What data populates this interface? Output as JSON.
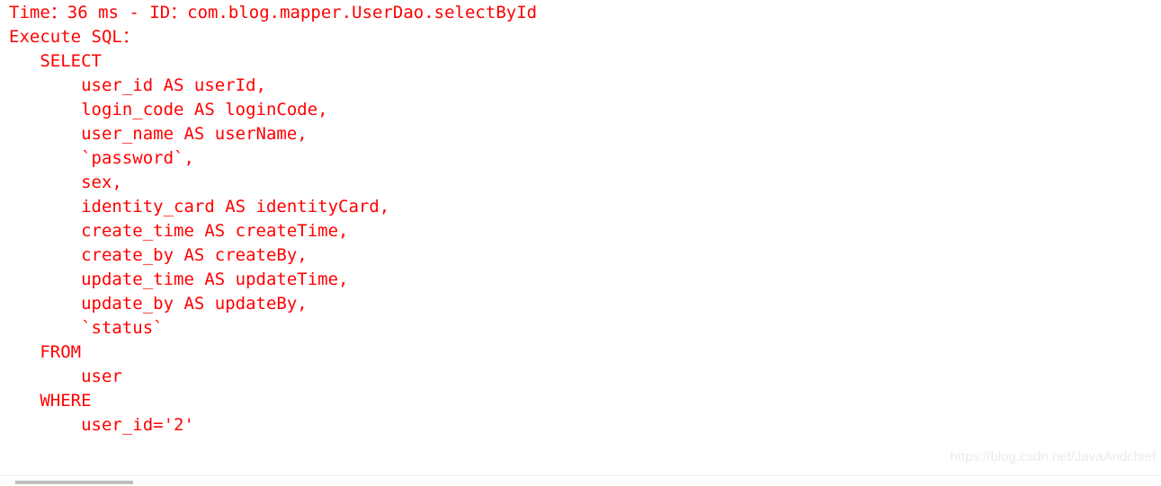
{
  "window": {
    "title": "Console",
    "background_color": "#ffffff"
  },
  "console": {
    "text_color": "#ff0000",
    "font_size_px": 19,
    "line_height_px": 27,
    "lines": [
      {
        "indent": 0,
        "text": "Time：36 ms - ID：com.blog.mapper.UserDao.selectById"
      },
      {
        "indent": 0,
        "text": "Execute SQL："
      },
      {
        "indent": 0,
        "text": "   SELECT"
      },
      {
        "indent": 0,
        "text": "       user_id AS userId,"
      },
      {
        "indent": 0,
        "text": "       login_code AS loginCode,"
      },
      {
        "indent": 0,
        "text": "       user_name AS userName,"
      },
      {
        "indent": 0,
        "text": "       `password`,"
      },
      {
        "indent": 0,
        "text": "       sex,"
      },
      {
        "indent": 0,
        "text": "       identity_card AS identityCard,"
      },
      {
        "indent": 0,
        "text": "       create_time AS createTime,"
      },
      {
        "indent": 0,
        "text": "       create_by AS createBy,"
      },
      {
        "indent": 0,
        "text": "       update_time AS updateTime,"
      },
      {
        "indent": 0,
        "text": "       update_by AS updateBy,"
      },
      {
        "indent": 0,
        "text": "       `status`"
      },
      {
        "indent": 0,
        "text": "   FROM"
      },
      {
        "indent": 0,
        "text": "       user"
      },
      {
        "indent": 0,
        "text": "   WHERE"
      },
      {
        "indent": 0,
        "text": "       user_id='2'"
      }
    ],
    "log_meta": {
      "time_label": "Time",
      "time_value": "36 ms",
      "id_label": "ID",
      "id_value": "com.blog.mapper.UserDao.selectById",
      "sql_label": "Execute SQL",
      "statement_type": "SELECT",
      "table": "user",
      "where_clause": "user_id='2'",
      "selected_columns": [
        "user_id AS userId",
        "login_code AS loginCode",
        "user_name AS userName",
        "`password`",
        "sex",
        "identity_card AS identityCard",
        "create_time AS createTime",
        "create_by AS createBy",
        "update_time AS updateTime",
        "update_by AS updateBy",
        "`status`"
      ]
    }
  },
  "watermark": {
    "text": "https://blog.csdn.net/JavaAndchief",
    "color": "#ebebeb"
  },
  "scrollbar": {
    "orientation": "horizontal",
    "thumb_color": "#bfbfbf",
    "track_color": "#ffffff"
  }
}
